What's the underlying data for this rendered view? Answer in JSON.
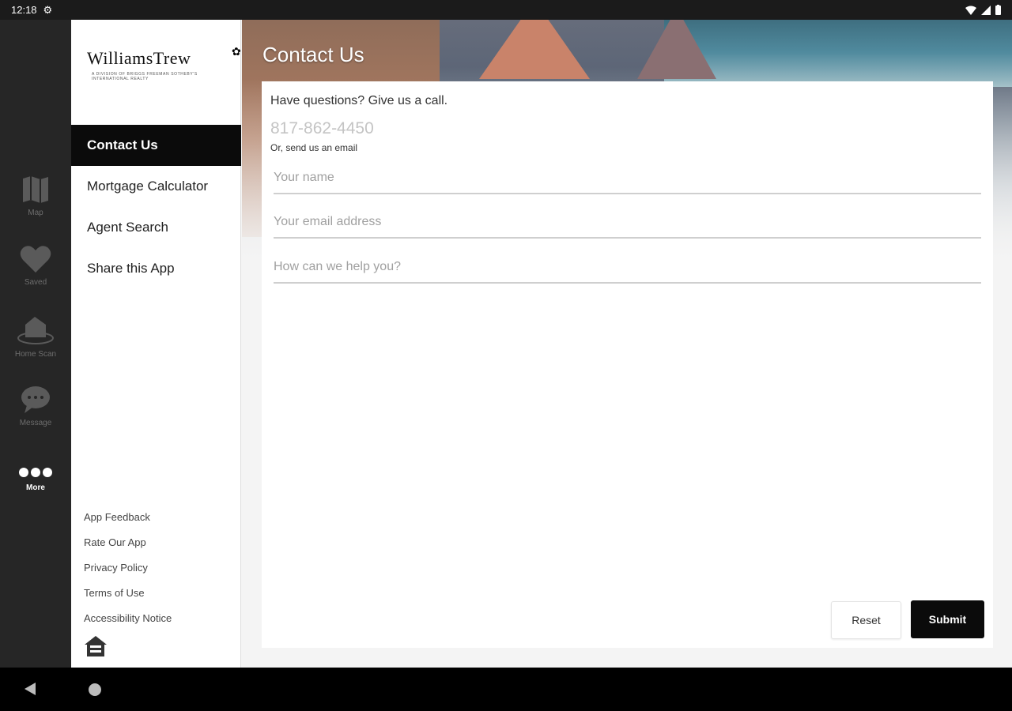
{
  "status_bar": {
    "time": "12:18"
  },
  "hero": {
    "title": "Contact Us"
  },
  "rail": {
    "items": [
      {
        "label": "Map",
        "icon": "map-icon"
      },
      {
        "label": "Saved",
        "icon": "heart-icon"
      },
      {
        "label": "Home Scan",
        "icon": "home-scan-icon"
      },
      {
        "label": "Message",
        "icon": "message-icon"
      },
      {
        "label": "More",
        "icon": "more-icon",
        "active": true
      }
    ]
  },
  "drawer": {
    "logo_name": "WilliamsTrew",
    "logo_sub": "A DIVISION OF BRIGGS FREEMAN SOTHEBY'S INTERNATIONAL REALTY",
    "menu": [
      {
        "label": "Contact Us",
        "active": true
      },
      {
        "label": "Mortgage Calculator"
      },
      {
        "label": "Agent Search"
      },
      {
        "label": "Share this App"
      }
    ],
    "links": [
      "App Feedback",
      "Rate Our App",
      "Privacy Policy",
      "Terms of Use",
      "Accessibility Notice"
    ]
  },
  "form": {
    "intro": "Have questions? Give us a call.",
    "phone": "817-862-4450",
    "email_note": "Or, send us an email",
    "name_placeholder": "Your name",
    "email_placeholder": "Your email address",
    "message_placeholder": "How can we help you?",
    "reset_label": "Reset",
    "submit_label": "Submit"
  }
}
